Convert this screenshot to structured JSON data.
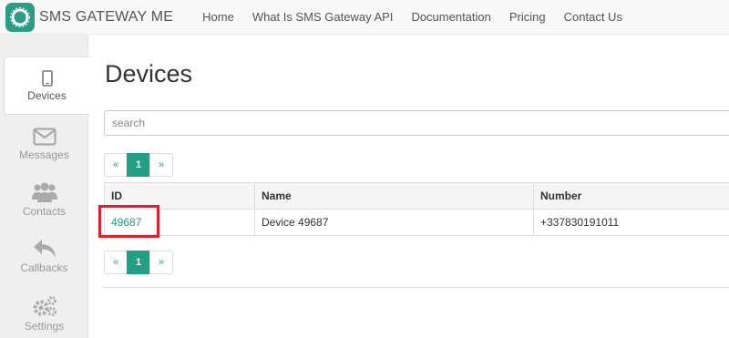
{
  "brand": {
    "name": "SMS GATEWAY ME"
  },
  "nav": [
    {
      "label": "Home"
    },
    {
      "label": "What Is SMS Gateway API"
    },
    {
      "label": "Documentation"
    },
    {
      "label": "Pricing"
    },
    {
      "label": "Contact Us"
    }
  ],
  "sidebar": [
    {
      "label": "Devices",
      "icon": "mobile-icon",
      "active": true
    },
    {
      "label": "Messages",
      "icon": "envelope-icon"
    },
    {
      "label": "Contacts",
      "icon": "users-icon"
    },
    {
      "label": "Callbacks",
      "icon": "reply-icon"
    },
    {
      "label": "Settings",
      "icon": "gears-icon"
    }
  ],
  "page": {
    "title": "Devices"
  },
  "search": {
    "placeholder": "search"
  },
  "pagination": {
    "prev": "«",
    "current": "1",
    "next": "»"
  },
  "table": {
    "headers": [
      "ID",
      "Name",
      "Number"
    ],
    "rows": [
      {
        "id": "49687",
        "name": "Device 49687",
        "number": "+337830191011"
      }
    ]
  },
  "colors": {
    "accent": "#21a086",
    "highlight": "#e0202c"
  }
}
